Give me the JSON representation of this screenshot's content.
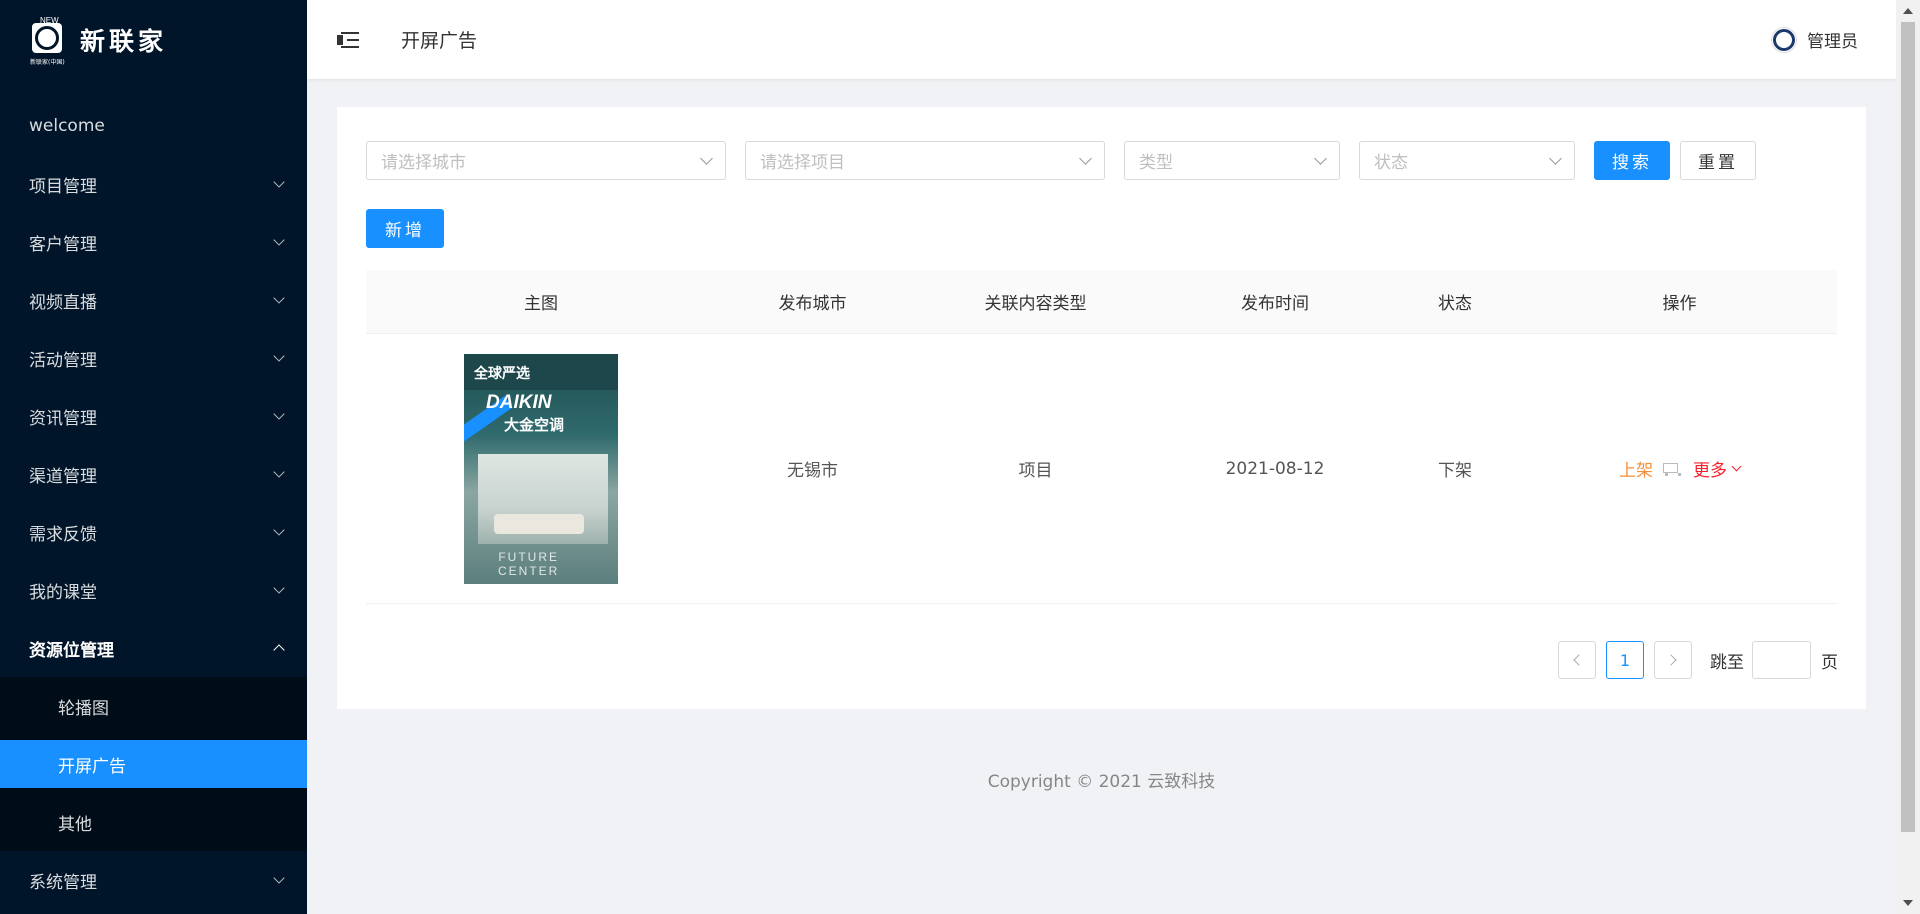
{
  "sidebar": {
    "logo": {
      "new_tag": "NEW",
      "sub_text": "新联家(中国)",
      "title": "新联家"
    },
    "items": [
      {
        "label": "welcome",
        "has_children": false
      },
      {
        "label": "项目管理",
        "has_children": true
      },
      {
        "label": "客户管理",
        "has_children": true
      },
      {
        "label": "视频直播",
        "has_children": true
      },
      {
        "label": "活动管理",
        "has_children": true
      },
      {
        "label": "资讯管理",
        "has_children": true
      },
      {
        "label": "渠道管理",
        "has_children": true
      },
      {
        "label": "需求反馈",
        "has_children": true
      },
      {
        "label": "我的课堂",
        "has_children": true
      },
      {
        "label": "资源位管理",
        "has_children": true,
        "open": true
      },
      {
        "label": "系统管理",
        "has_children": true
      }
    ],
    "submenu": [
      {
        "label": "轮播图"
      },
      {
        "label": "开屏广告",
        "active": true
      },
      {
        "label": "其他"
      }
    ]
  },
  "header": {
    "title": "开屏广告",
    "user_name": "管理员"
  },
  "filters": {
    "city_placeholder": "请选择城市",
    "project_placeholder": "请选择项目",
    "type_placeholder": "类型",
    "status_placeholder": "状态",
    "search_label": "搜索",
    "reset_label": "重置",
    "add_label": "新增"
  },
  "table": {
    "columns": [
      "主图",
      "发布城市",
      "关联内容类型",
      "发布时间",
      "状态",
      "操作"
    ],
    "rows": [
      {
        "poster": {
          "top_text": "全球严选",
          "brand": "DAIKIN",
          "brand_cn": "大金空调",
          "bottom_line1": "FUTURE",
          "bottom_line2": "CENTER"
        },
        "city": "无锡市",
        "content_type": "项目",
        "publish_date": "2021-08-12",
        "status": "下架",
        "action_publish": "上架",
        "action_more": "更多"
      }
    ]
  },
  "pagination": {
    "current_page": "1",
    "jump_label": "跳至",
    "page_suffix": "页"
  },
  "footer": {
    "copyright": "Copyright © 2021 云致科技"
  },
  "colors": {
    "sidebar_bg": "#001529",
    "primary": "#1890ff",
    "publish_link": "#f58f3a",
    "more_link": "#f5222d"
  }
}
